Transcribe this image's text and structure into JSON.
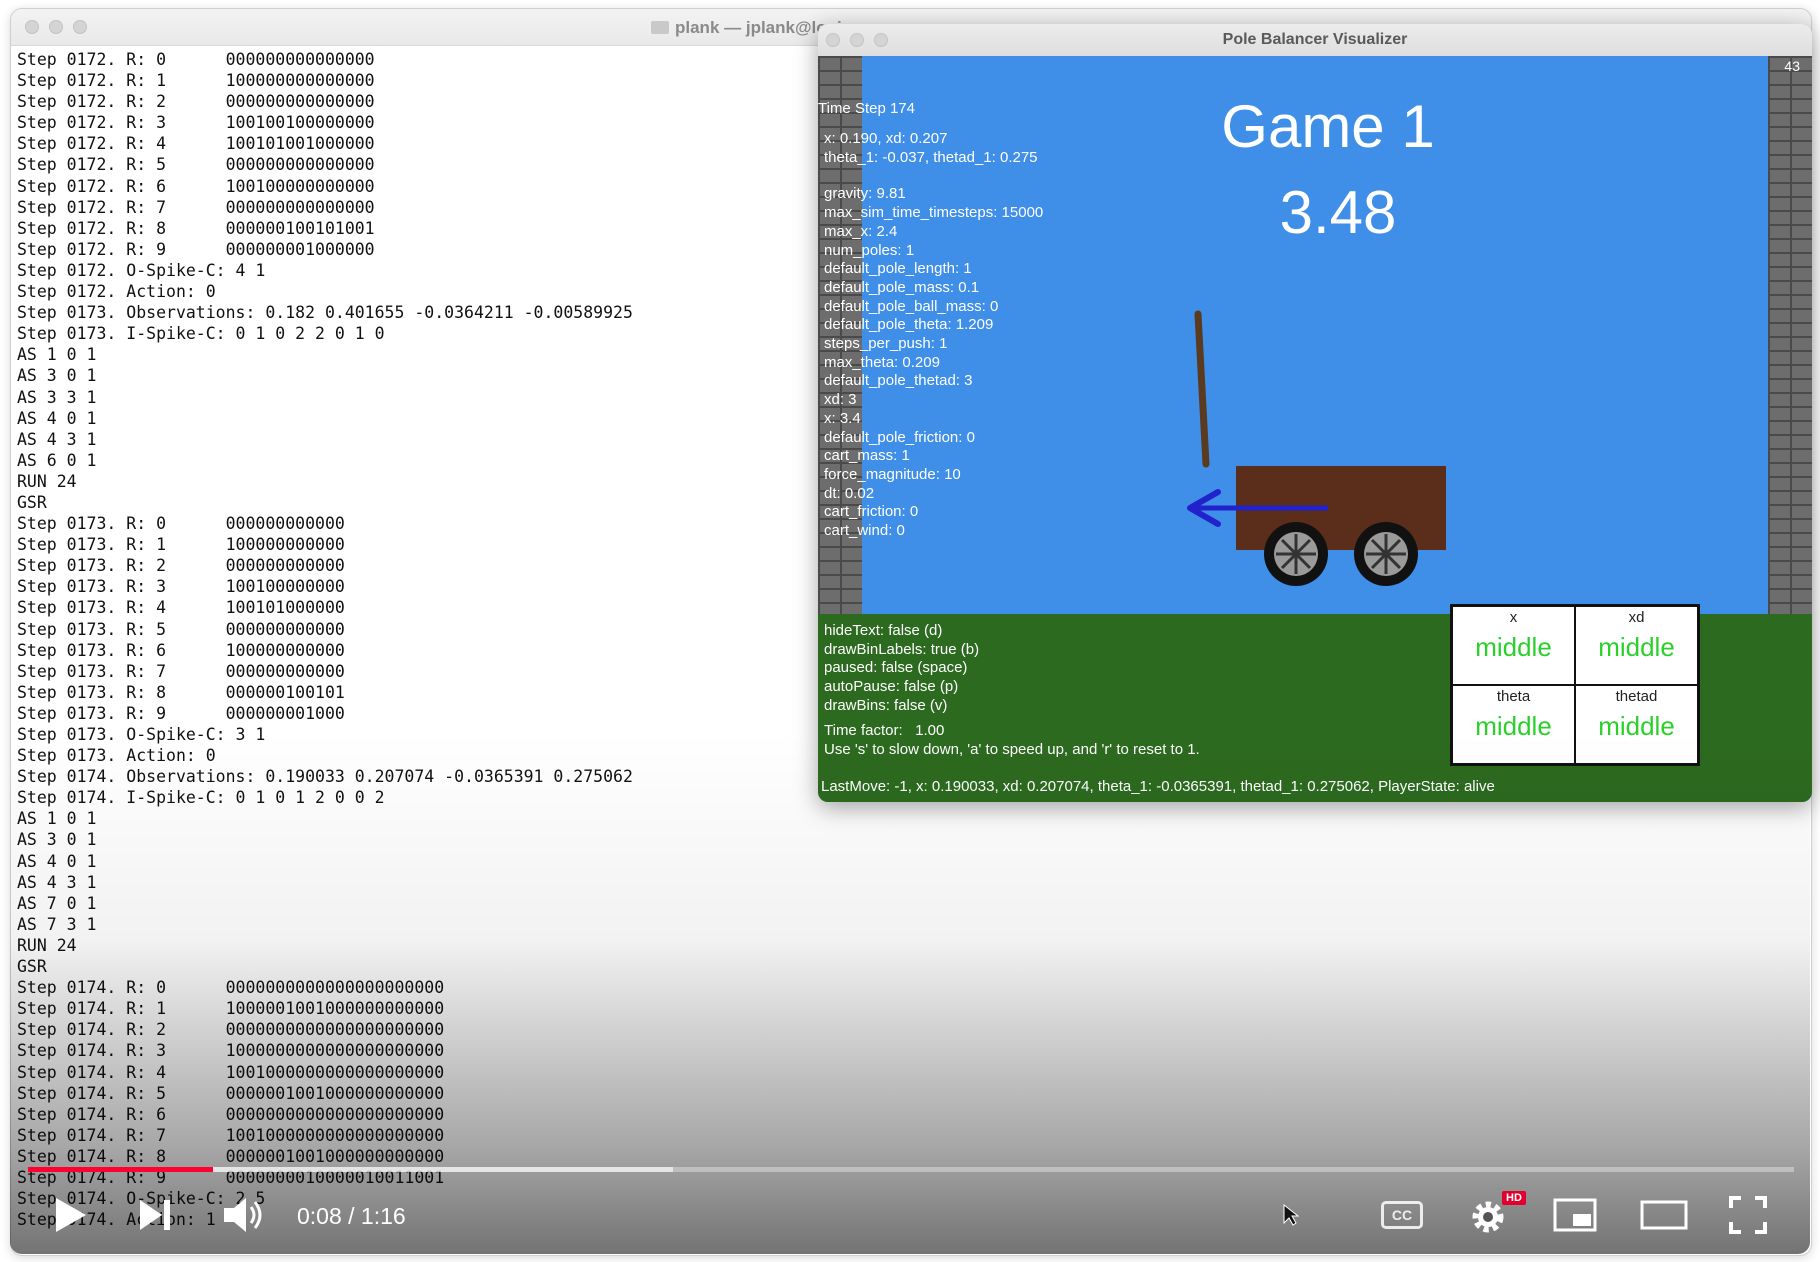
{
  "terminal": {
    "title": "plank — jplank@logi",
    "lines": [
      "Step 0172. R: 0      000000000000000",
      "Step 0172. R: 1      100000000000000",
      "Step 0172. R: 2      000000000000000",
      "Step 0172. R: 3      100100100000000",
      "Step 0172. R: 4      100101001000000",
      "Step 0172. R: 5      000000000000000",
      "Step 0172. R: 6      100100000000000",
      "Step 0172. R: 7      000000000000000",
      "Step 0172. R: 8      000000100101001",
      "Step 0172. R: 9      000000001000000",
      "Step 0172. O-Spike-C: 4 1",
      "Step 0172. Action: 0",
      "Step 0173. Observations: 0.182 0.401655 -0.0364211 -0.00589925",
      "Step 0173. I-Spike-C: 0 1 0 2 2 0 1 0",
      "AS 1 0 1",
      "AS 3 0 1",
      "AS 3 3 1",
      "AS 4 0 1",
      "AS 4 3 1",
      "AS 6 0 1",
      "RUN 24",
      "GSR",
      "Step 0173. R: 0      000000000000",
      "Step 0173. R: 1      100000000000",
      "Step 0173. R: 2      000000000000",
      "Step 0173. R: 3      100100000000",
      "Step 0173. R: 4      100101000000",
      "Step 0173. R: 5      000000000000",
      "Step 0173. R: 6      100000000000",
      "Step 0173. R: 7      000000000000",
      "Step 0173. R: 8      000000100101",
      "Step 0173. R: 9      000000001000",
      "Step 0173. O-Spike-C: 3 1",
      "Step 0173. Action: 0",
      "Step 0174. Observations: 0.190033 0.207074 -0.0365391 0.275062",
      "Step 0174. I-Spike-C: 0 1 0 1 2 0 0 2",
      "AS 1 0 1",
      "AS 3 0 1",
      "AS 4 0 1",
      "AS 4 3 1",
      "AS 7 0 1",
      "AS 7 3 1",
      "RUN 24",
      "GSR",
      "Step 0174. R: 0      0000000000000000000000",
      "Step 0174. R: 1      1000001001000000000000",
      "Step 0174. R: 2      0000000000000000000000",
      "Step 0174. R: 3      1000000000000000000000",
      "Step 0174. R: 4      1001000000000000000000",
      "Step 0174. R: 5      0000001001000000000000",
      "Step 0174. R: 6      0000000000000000000000",
      "Step 0174. R: 7      1001000000000000000000",
      "Step 0174. R: 8      0000001001000000000000",
      "Step 0174. R: 9      0000000010000010011001",
      "Step 0174. O-Spike-C: 2 5",
      "Step 0174. Action: 1"
    ]
  },
  "pole_window": {
    "title": "Pole Balancer Visualizer",
    "fps": "43",
    "time_step": "Time Step 174",
    "game_title": "Game 1",
    "score": "3.48",
    "state_lines": [
      "x:  0.190, xd:  0.207",
      "theta_1: -0.037, thetad_1:  0.275"
    ],
    "params": [
      "gravity: 9.81",
      "max_sim_time_timesteps: 15000",
      "max_x: 2.4",
      "num_poles: 1",
      "default_pole_length: 1",
      "default_pole_mass: 0.1",
      "default_pole_ball_mass: 0",
      "default_pole_theta: 1.209",
      "steps_per_push: 1",
      "max_theta: 0.209",
      "default_pole_thetad: 3",
      "xd: 3",
      "x: 3.4",
      "default_pole_friction: 0",
      "cart_mass: 1",
      "force_magnitude: 10",
      "dt: 0.02",
      "cart_friction: 0",
      "cart_wind: 0"
    ],
    "controls": [
      "hideText: false (d)",
      "drawBinLabels: true (b)",
      "paused: false (space)",
      "autoPause: false (p)",
      "drawBins: false (v)"
    ],
    "time_factor": "Time factor:   1.00",
    "speed_hint": "Use 's' to slow down, 'a' to speed up, and 'r' to reset to 1.",
    "status": "LastMove: -1, x: 0.190033, xd: 0.207074, theta_1: -0.0365391, thetad_1: 0.275062, PlayerState: alive",
    "bins": [
      {
        "label": "x",
        "value": "middle"
      },
      {
        "label": "xd",
        "value": "middle"
      },
      {
        "label": "theta",
        "value": "middle"
      },
      {
        "label": "thetad",
        "value": "middle"
      }
    ],
    "colors": {
      "sky": "#3f8ee8",
      "ground": "#2c6a1f",
      "cart": "#5a2e1a",
      "arrow": "#2222cc",
      "bin_text": "#2bd02b"
    }
  },
  "player": {
    "time": "0:08 / 1:16",
    "progress_played": 0.105,
    "progress_loaded": 0.365,
    "cc_label": "CC",
    "hd_label": "HD"
  }
}
